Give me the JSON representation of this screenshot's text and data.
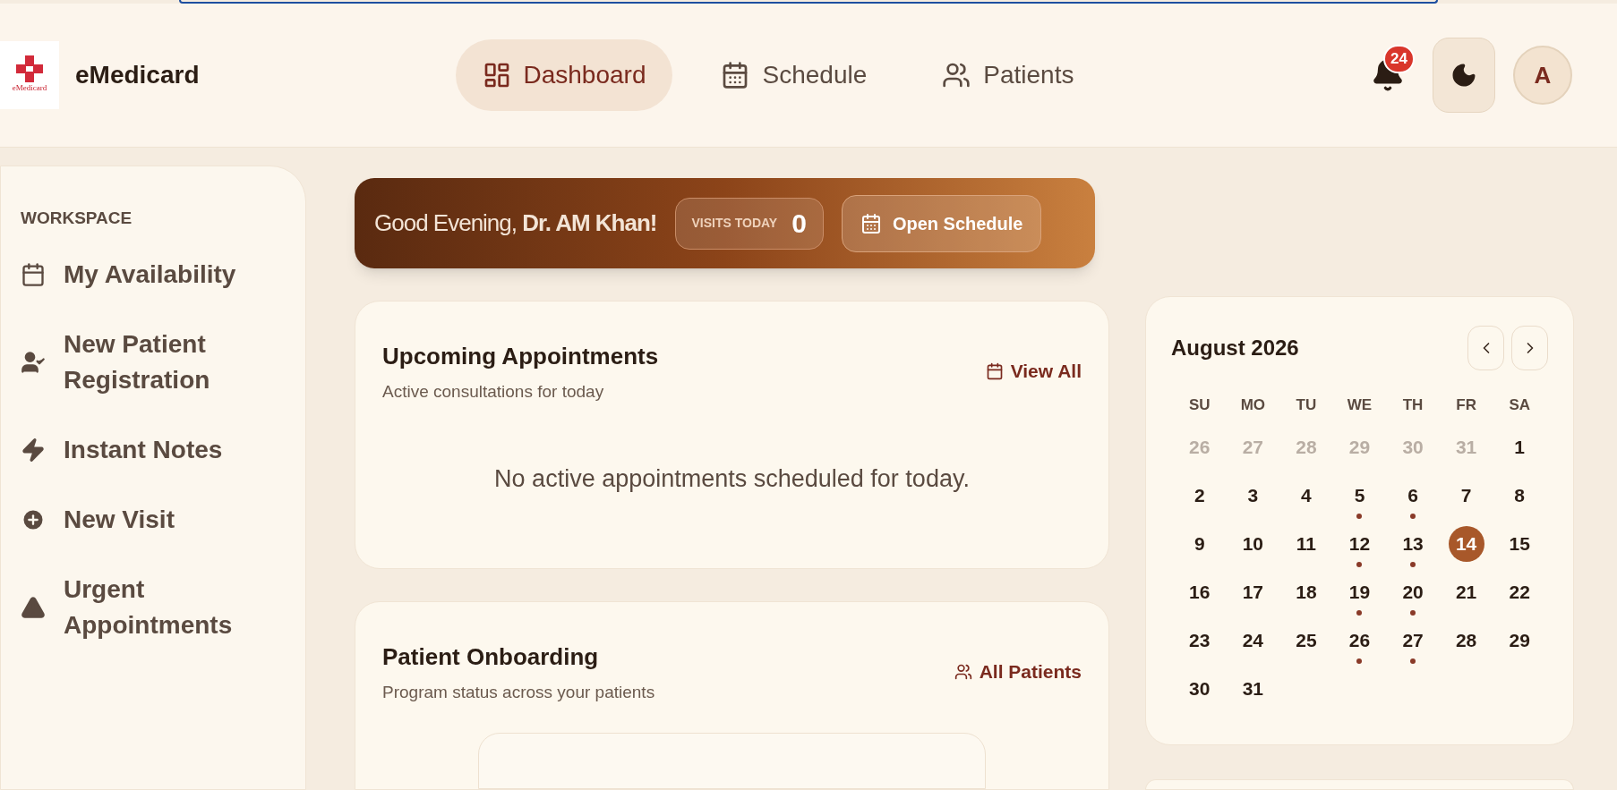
{
  "header": {
    "logo_text": "eMedicard",
    "brand": "eMedicard",
    "nav": [
      {
        "label": "Dashboard",
        "selected": true
      },
      {
        "label": "Schedule",
        "selected": false
      },
      {
        "label": "Patients",
        "selected": false
      }
    ],
    "notifications": "24",
    "avatar": "A"
  },
  "sidebar": {
    "heading": "WORKSPACE",
    "items": [
      {
        "label": "My Availability"
      },
      {
        "label": "New Patient Registration"
      },
      {
        "label": "Instant Notes"
      },
      {
        "label": "New Visit"
      },
      {
        "label": "Urgent Appointments"
      }
    ]
  },
  "banner": {
    "greeting": "Good Evening, **Dr. AM Khan!**",
    "visits_label": "VISITS TODAY",
    "visits_count": "0",
    "button": "Open Schedule"
  },
  "appointments": {
    "title": "Upcoming Appointments",
    "subtitle": "Active consultations for today",
    "link": "View All",
    "empty": "No active appointments scheduled for today."
  },
  "onboarding": {
    "title": "Patient Onboarding",
    "subtitle": "Program status across your patients",
    "link": "All Patients"
  },
  "calendar": {
    "month": "August 2026",
    "weekdays": [
      "SU",
      "MO",
      "TU",
      "WE",
      "TH",
      "FR",
      "SA"
    ],
    "days": [
      {
        "label": "26",
        "muted": true,
        "dot": false,
        "selected": false
      },
      {
        "label": "27",
        "muted": true,
        "dot": false,
        "selected": false
      },
      {
        "label": "28",
        "muted": true,
        "dot": false,
        "selected": false
      },
      {
        "label": "29",
        "muted": true,
        "dot": false,
        "selected": false
      },
      {
        "label": "30",
        "muted": true,
        "dot": false,
        "selected": false
      },
      {
        "label": "31",
        "muted": true,
        "dot": false,
        "selected": false
      },
      {
        "label": "1",
        "muted": false,
        "dot": false,
        "selected": false
      },
      {
        "label": "2",
        "muted": false,
        "dot": false,
        "selected": false
      },
      {
        "label": "3",
        "muted": false,
        "dot": false,
        "selected": false
      },
      {
        "label": "4",
        "muted": false,
        "dot": false,
        "selected": false
      },
      {
        "label": "5",
        "muted": false,
        "dot": true,
        "selected": false
      },
      {
        "label": "6",
        "muted": false,
        "dot": true,
        "selected": false
      },
      {
        "label": "7",
        "muted": false,
        "dot": false,
        "selected": false
      },
      {
        "label": "8",
        "muted": false,
        "dot": false,
        "selected": false
      },
      {
        "label": "9",
        "muted": false,
        "dot": false,
        "selected": false
      },
      {
        "label": "10",
        "muted": false,
        "dot": false,
        "selected": false
      },
      {
        "label": "11",
        "muted": false,
        "dot": false,
        "selected": false
      },
      {
        "label": "12",
        "muted": false,
        "dot": true,
        "selected": false
      },
      {
        "label": "13",
        "muted": false,
        "dot": true,
        "selected": false
      },
      {
        "label": "14",
        "muted": false,
        "dot": false,
        "selected": true
      },
      {
        "label": "15",
        "muted": false,
        "dot": false,
        "selected": false
      },
      {
        "label": "16",
        "muted": false,
        "dot": false,
        "selected": false
      },
      {
        "label": "17",
        "muted": false,
        "dot": false,
        "selected": false
      },
      {
        "label": "18",
        "muted": false,
        "dot": false,
        "selected": false
      },
      {
        "label": "19",
        "muted": false,
        "dot": true,
        "selected": false
      },
      {
        "label": "20",
        "muted": false,
        "dot": true,
        "selected": false
      },
      {
        "label": "21",
        "muted": false,
        "dot": false,
        "selected": false
      },
      {
        "label": "22",
        "muted": false,
        "dot": false,
        "selected": false
      },
      {
        "label": "23",
        "muted": false,
        "dot": false,
        "selected": false
      },
      {
        "label": "24",
        "muted": false,
        "dot": false,
        "selected": false
      },
      {
        "label": "25",
        "muted": false,
        "dot": false,
        "selected": false
      },
      {
        "label": "26",
        "muted": false,
        "dot": true,
        "selected": false
      },
      {
        "label": "27",
        "muted": false,
        "dot": true,
        "selected": false
      },
      {
        "label": "28",
        "muted": false,
        "dot": false,
        "selected": false
      },
      {
        "label": "29",
        "muted": false,
        "dot": false,
        "selected": false
      },
      {
        "label": "30",
        "muted": false,
        "dot": false,
        "selected": false
      },
      {
        "label": "31",
        "muted": false,
        "dot": false,
        "selected": false
      }
    ]
  }
}
